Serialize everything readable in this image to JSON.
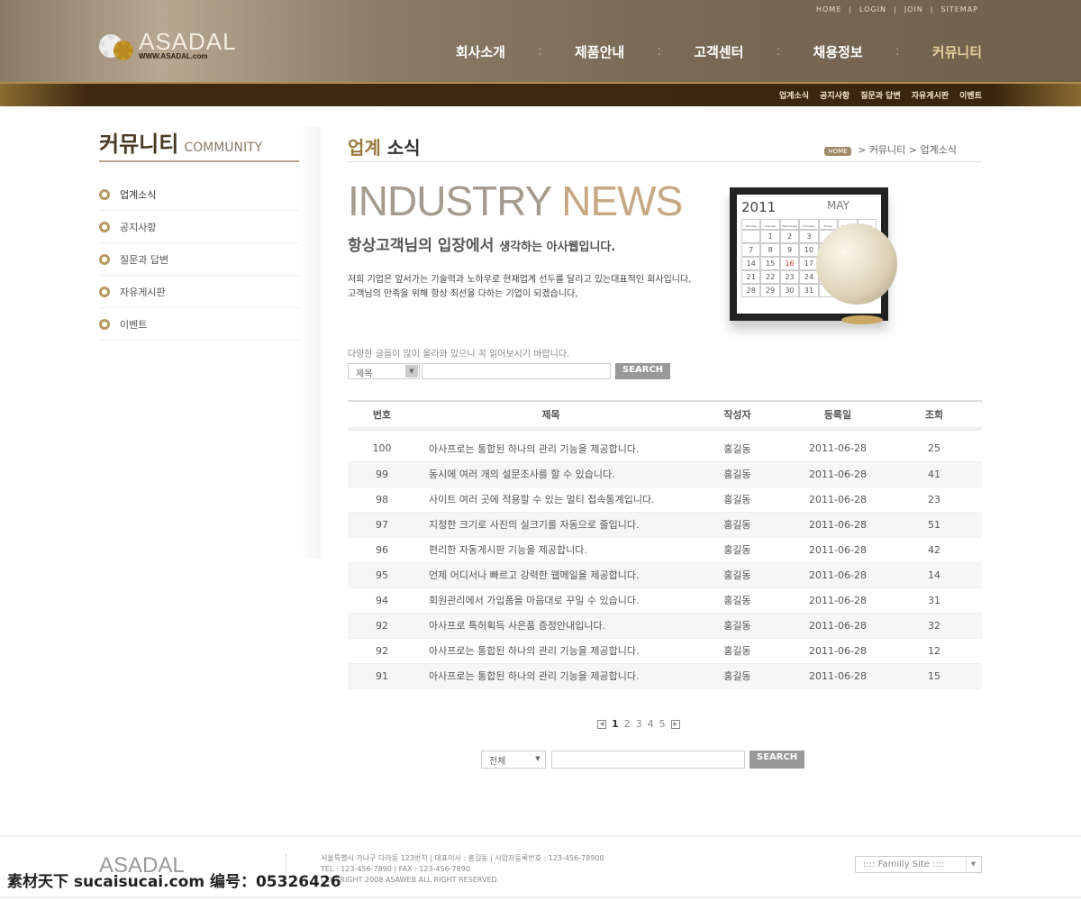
{
  "header": {
    "util_links": [
      "HOME",
      "LOGIN",
      "JOIN",
      "SITEMAP"
    ],
    "logo": "ASADAL",
    "logo_url_text": "WWW.ASADAL.com",
    "nav": [
      "회사소개",
      "제품안내",
      "고객센터",
      "채용정보",
      "커뮤니티"
    ],
    "active_nav": "커뮤니티",
    "subnav": [
      "업계소식",
      "공지사항",
      "질문과 답변",
      "자유게시판",
      "이벤트"
    ]
  },
  "sidebar": {
    "title": "커뮤니티",
    "title_en": "COMMUNITY",
    "items": [
      "업계소식",
      "공지사항",
      "질문과 답변",
      "자유게시판",
      "이벤트"
    ]
  },
  "main": {
    "title_a": "업계",
    "title_b": "소식",
    "breadcrumb": {
      "home": "HOME",
      "items": [
        "커뮤니티",
        "업계소식"
      ],
      "sep": ">"
    },
    "banner_a": "INDUSTRY",
    "banner_b": "NEWS",
    "slogan_a": "항상고객님의 입장에서",
    "slogan_b": "생각하는 아사웹입니다.",
    "desc1": "저희 기업은 앞서가는 기술력과 노하우로 현재업계 선두를 달리고 있는대표적인 회사입니다,",
    "desc2": "고객님의 만족을 위해 항상 최선을 다하는 기업이 되겠습니다,",
    "calendar": {
      "year": "2011",
      "month": "MAY",
      "days": [
        "Monday",
        "Tuesday",
        "Wednesday",
        "Thursday",
        "Friday",
        "Saturday",
        "Sunday"
      ],
      "cells": [
        "",
        "1",
        "2",
        "3",
        "",
        "",
        "",
        "7",
        "8",
        "9",
        "10",
        "",
        "",
        "",
        "14",
        "15",
        "16",
        "17",
        "",
        "",
        "",
        "21",
        "22",
        "23",
        "24",
        "",
        "",
        "",
        "28",
        "29",
        "30",
        "31",
        "",
        "",
        ""
      ],
      "highlight": "16"
    },
    "hint": "다양한 글들이 많이 올라와 있으니 꼭 읽어보시기 바랍니다.",
    "search_select": "제목",
    "search_input": "",
    "search_button": "SEARCH",
    "table": {
      "headers": [
        "번호",
        "제목",
        "작성자",
        "등록일",
        "조회"
      ],
      "rows": [
        [
          "100",
          "아사프로는 통합된 하나의 관리 기능을 제공합니다.",
          "홍길동",
          "2011-06-28",
          "25"
        ],
        [
          "99",
          "동시에 여러 개의 설문조사를 할 수 있습니다.",
          "홍길동",
          "2011-06-28",
          "41"
        ],
        [
          "98",
          "사이트 여러 곳에 적용할 수 있는 멀티 접속통계입니다.",
          "홍길동",
          "2011-06-28",
          "23"
        ],
        [
          "97",
          "지정한 크기로 사진의 실크기를 자동으로 줄입니다.",
          "홍길동",
          "2011-06-28",
          "51"
        ],
        [
          "96",
          "편리한 자동게시판 기능을 제공합니다.",
          "홍길동",
          "2011-06-28",
          "42"
        ],
        [
          "95",
          "언제 어디서나 빠르고 강력한 웹메일을 제공합니다.",
          "홍길동",
          "2011-06-28",
          "14"
        ],
        [
          "94",
          "회원관리에서 가입폼을 마음대로 꾸밀 수 있습니다.",
          "홍길동",
          "2011-06-28",
          "31"
        ],
        [
          "92",
          "아사프로 특허획득 사은품 증정안내입니다.",
          "홍길동",
          "2011-06-28",
          "32"
        ],
        [
          "92",
          "아사프로는 통합된 하나의 관리 기능을 제공합니다.",
          "홍길동",
          "2011-06-28",
          "12"
        ],
        [
          "91",
          "아사프로는 통합된 하나의 관리 기능을 제공합니다.",
          "홍길동",
          "2011-06-28",
          "15"
        ]
      ]
    },
    "pager": {
      "pages": [
        "1",
        "2",
        "3",
        "4",
        "5"
      ],
      "current": "1"
    },
    "bottom_search": {
      "select": "전체",
      "input": "",
      "button": "SEARCH"
    }
  },
  "footer": {
    "logo": "ASADAL",
    "line1": "서울특별시 가나구 다라동 123번지 | 대표이사 : 홍길동 | 사업자등록번호 : 123-456-78900",
    "line2": "TEL : 123-456-7890 | FAX : 123-456-7890",
    "line3": "COPYRIGHT 2008 ASAWEB ALL RIGHT RESERVED.",
    "family_site": ":::: Familly Site ::::"
  },
  "watermark": "素材天下 sucaisucai.com  编号：05326426"
}
